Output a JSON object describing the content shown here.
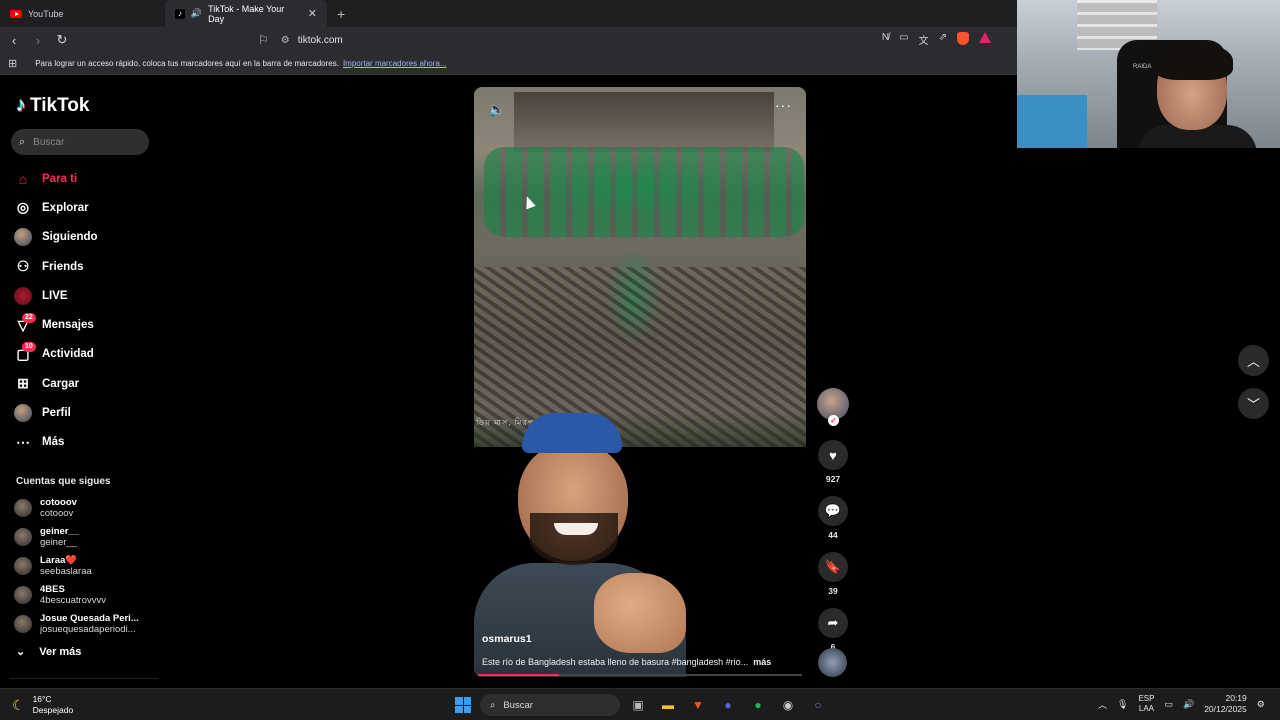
{
  "browser": {
    "tabs": [
      {
        "label": "YouTube",
        "active": false
      },
      {
        "label": "TikTok - Make Your Day",
        "active": true
      }
    ],
    "url": "tiktok.com",
    "bookmarks_hint": "Para lograr un acceso rápido, coloca tus marcadores aquí en la barra de marcadores.",
    "bookmarks_link": "Importar marcadores ahora..."
  },
  "tiktok": {
    "logo": "TikTok",
    "search_placeholder": "Buscar",
    "nav": [
      {
        "label": "Para ti",
        "icon": "home-icon",
        "active": true
      },
      {
        "label": "Explorar",
        "icon": "compass-icon"
      },
      {
        "label": "Siguiendo",
        "icon": "avatar-icon"
      },
      {
        "label": "Friends",
        "icon": "friends-icon"
      },
      {
        "label": "LIVE",
        "icon": "live-icon"
      },
      {
        "label": "Mensajes",
        "icon": "messages-icon",
        "badge": "22"
      },
      {
        "label": "Actividad",
        "icon": "activity-icon",
        "badge": "10"
      },
      {
        "label": "Cargar",
        "icon": "upload-icon"
      },
      {
        "label": "Perfil",
        "icon": "profile-icon"
      },
      {
        "label": "Más",
        "icon": "more-icon"
      }
    ],
    "following_title": "Cuentas que sigues",
    "following": [
      {
        "name": "cotooov",
        "handle": "cotooov"
      },
      {
        "name": "geiner__",
        "handle": "geiner__"
      },
      {
        "name": "Laraa❤️",
        "handle": "seebaslaraa"
      },
      {
        "name": "4BES",
        "handle": "4bescuatrovvvv"
      },
      {
        "name": "Josue Quesada Peri...",
        "handle": "josuequesadaperiodi..."
      }
    ],
    "see_more": "Ver más"
  },
  "video": {
    "author": "osmarus1",
    "description": "Este río de Bangladesh estaba lleno de basura #bangladesh #rio...",
    "more_label": "más",
    "overlay_text": "ডিয় মাস, মিরপুর ২০২৩",
    "progress": 0.25,
    "likes": "927",
    "comments": "44",
    "saves": "39",
    "shares": "6"
  },
  "taskbar": {
    "temperature": "16°C",
    "condition": "Despejado",
    "search_label": "Buscar",
    "lang_top": "ESP",
    "lang_bottom": "LAA",
    "time": "20:19",
    "date": "20/12/2025"
  },
  "colors": {
    "accent": "#fe2c55",
    "background": "#000000",
    "chrome": "#2b2b30"
  }
}
